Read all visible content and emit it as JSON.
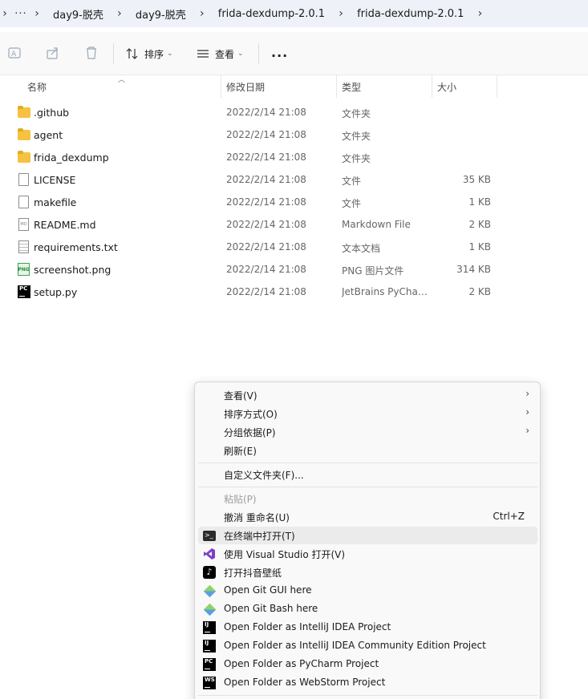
{
  "breadcrumb": {
    "more_icon": "ellipsis-icon",
    "items": [
      "day9-脱壳",
      "day9-脱壳",
      "frida-dexdump-2.0.1",
      "frida-dexdump-2.0.1"
    ]
  },
  "toolbar": {
    "sort_label": "排序",
    "view_label": "查看",
    "more_label": "..."
  },
  "columns": {
    "name": "名称",
    "date": "修改日期",
    "type": "类型",
    "size": "大小"
  },
  "files": [
    {
      "name": ".github",
      "date": "2022/2/14 21:08",
      "type": "文件夹",
      "size": "",
      "icon": "folder"
    },
    {
      "name": "agent",
      "date": "2022/2/14 21:08",
      "type": "文件夹",
      "size": "",
      "icon": "folder"
    },
    {
      "name": "frida_dexdump",
      "date": "2022/2/14 21:08",
      "type": "文件夹",
      "size": "",
      "icon": "folder"
    },
    {
      "name": "LICENSE",
      "date": "2022/2/14 21:08",
      "type": "文件",
      "size": "35 KB",
      "icon": "file"
    },
    {
      "name": "makefile",
      "date": "2022/2/14 21:08",
      "type": "文件",
      "size": "1 KB",
      "icon": "file"
    },
    {
      "name": "README.md",
      "date": "2022/2/14 21:08",
      "type": "Markdown File",
      "size": "2 KB",
      "icon": "markdown"
    },
    {
      "name": "requirements.txt",
      "date": "2022/2/14 21:08",
      "type": "文本文档",
      "size": "1 KB",
      "icon": "text"
    },
    {
      "name": "screenshot.png",
      "date": "2022/2/14 21:08",
      "type": "PNG 图片文件",
      "size": "314 KB",
      "icon": "png"
    },
    {
      "name": "setup.py",
      "date": "2022/2/14 21:08",
      "type": "JetBrains PyChar...",
      "size": "2 KB",
      "icon": "pycharm"
    }
  ],
  "context_menu": {
    "view": "查看(V)",
    "sort_by": "排序方式(O)",
    "group_by": "分组依据(P)",
    "refresh": "刷新(E)",
    "customize": "自定义文件夹(F)...",
    "paste": "粘贴(P)",
    "undo_rename": "撤消 重命名(U)",
    "undo_shortcut": "Ctrl+Z",
    "open_terminal": "在终端中打开(T)",
    "open_vs": "使用 Visual Studio 打开(V)",
    "open_douyin": "打开抖音壁纸",
    "git_gui": "Open Git GUI here",
    "git_bash": "Open Git Bash here",
    "idea": "Open Folder as IntelliJ IDEA Project",
    "idea_ce": "Open Folder as IntelliJ IDEA Community Edition Project",
    "pycharm": "Open Folder as PyCharm Project",
    "webstorm": "Open Folder as WebStorm Project",
    "icons": {
      "terminal": "terminal-icon",
      "vs": "visual-studio-icon",
      "douyin": "tiktok-icon",
      "git": "git-icon",
      "jetbrains_ij": "IJ",
      "jetbrains_pc": "PC",
      "jetbrains_ws": "WS"
    }
  }
}
